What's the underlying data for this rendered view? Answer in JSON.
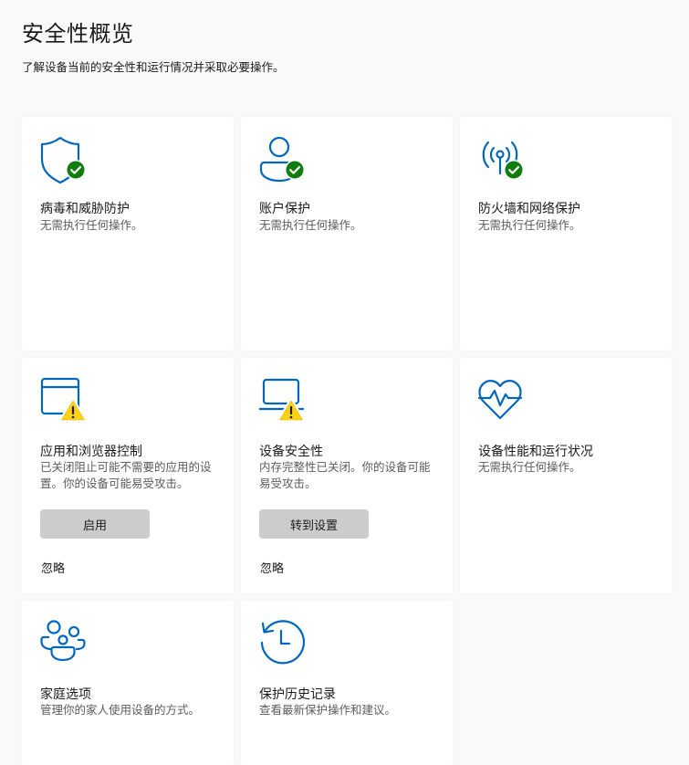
{
  "header": {
    "title": "安全性概览",
    "subtitle": "了解设备当前的安全性和运行情况并采取必要操作。"
  },
  "colors": {
    "accent": "#0067c0",
    "ok_badge": "#107c10",
    "warn_badge": "#fcd116",
    "button_bg": "#cccccc"
  },
  "cards": [
    {
      "title": "病毒和威胁防护",
      "desc": "无需执行任何操作。",
      "icon": "shield-icon",
      "status": "ok"
    },
    {
      "title": "账户保护",
      "desc": "无需执行任何操作。",
      "icon": "person-icon",
      "status": "ok"
    },
    {
      "title": "防火墙和网络保护",
      "desc": "无需执行任何操作。",
      "icon": "antenna-icon",
      "status": "ok"
    },
    {
      "title": "应用和浏览器控制",
      "desc": "已关闭阻止可能不需要的应用的设置。你的设备可能易受攻击。",
      "icon": "app-window-icon",
      "status": "warning",
      "button_label": "启用",
      "dismiss_label": "忽略"
    },
    {
      "title": "设备安全性",
      "desc": "内存完整性已关闭。你的设备可能易受攻击。",
      "icon": "laptop-icon",
      "status": "warning",
      "button_label": "转到设置",
      "dismiss_label": "忽略"
    },
    {
      "title": "设备性能和运行状况",
      "desc": "无需执行任何操作。",
      "icon": "heart-pulse-icon",
      "status": "none"
    },
    {
      "title": "家庭选项",
      "desc": "管理你的家人使用设备的方式。",
      "icon": "family-icon",
      "status": "none"
    },
    {
      "title": "保护历史记录",
      "desc": "查看最新保护操作和建议。",
      "icon": "history-icon",
      "status": "none"
    }
  ]
}
